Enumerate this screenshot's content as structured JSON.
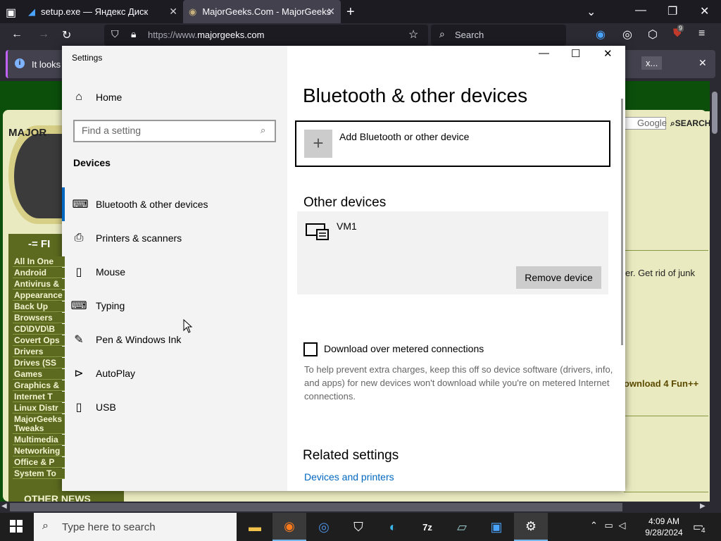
{
  "browser": {
    "tabs": [
      {
        "title": "setup.exe — Яндекс Диск"
      },
      {
        "title": "MajorGeeks.Com - MajorGeeks"
      }
    ],
    "url_prefix": "https://www.",
    "url_domain": "majorgeeks.com",
    "search_placeholder": "Search",
    "extension_badge": "9",
    "notification_text": "It looks",
    "notification_action": "x..."
  },
  "webpage": {
    "nav_links": [
      "All In One",
      "Android",
      "Antivirus &",
      "Appearance",
      "Back Up",
      "Browsers",
      "CD\\DVD\\B",
      "Covert Ops",
      "Drivers",
      "Drives (SS",
      "Games",
      "Graphics &",
      "Internet T",
      "Linux Distr",
      "MajorGeeks",
      "Tweaks",
      "Multimedia",
      "Networking",
      "Office & P",
      "System To"
    ],
    "files_header": "-= FI",
    "search_engine": "Google",
    "search_button": "SEARCH",
    "snippet_1": "er. Get rid of junk",
    "snippet_2": "ownload 4 Fun++",
    "other_news": "OTHER NEWS",
    "logo_text": "MAJOR"
  },
  "settings": {
    "window_title": "Settings",
    "home": "Home",
    "find_placeholder": "Find a setting",
    "section": "Devices",
    "nav": [
      {
        "label": "Bluetooth & other devices",
        "icon": "bluetooth-devices-icon"
      },
      {
        "label": "Printers & scanners",
        "icon": "printer-icon"
      },
      {
        "label": "Mouse",
        "icon": "mouse-icon"
      },
      {
        "label": "Typing",
        "icon": "keyboard-icon"
      },
      {
        "label": "Pen & Windows Ink",
        "icon": "pen-icon"
      },
      {
        "label": "AutoPlay",
        "icon": "autoplay-icon"
      },
      {
        "label": "USB",
        "icon": "usb-icon"
      }
    ],
    "page_title": "Bluetooth & other devices",
    "add_device": "Add Bluetooth or other device",
    "other_devices_header": "Other devices",
    "device_name": "VM1",
    "remove_button": "Remove device",
    "metered_label": "Download over metered connections",
    "metered_help": "To help prevent extra charges, keep this off so device software (drivers, info, and apps) for new devices won't download while you're on metered Internet connections.",
    "related_header": "Related settings",
    "related_link": "Devices and printers"
  },
  "taskbar": {
    "search_placeholder": "Type here to search",
    "time": "4:09 AM",
    "date": "9/28/2024",
    "notification_count": "4"
  },
  "colors": {
    "accent": "#0067c0",
    "browser_dark": "#1c1b22",
    "site_green": "#0b4f0b"
  }
}
